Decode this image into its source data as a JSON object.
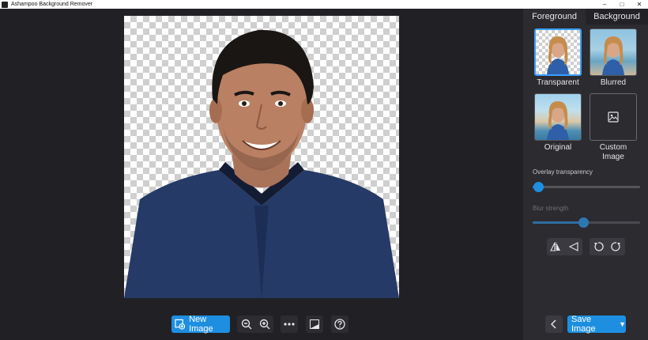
{
  "window": {
    "title": "Ashampoo Background Remover"
  },
  "toolbar": {
    "new_image_label": "New Image",
    "zoom_out_icon": "zoom-out-icon",
    "zoom_in_icon": "zoom-in-icon",
    "more_icon": "more-icon",
    "compare_icon": "compare-icon",
    "help_icon": "help-icon"
  },
  "panel": {
    "tabs": [
      {
        "label": "Foreground"
      },
      {
        "label": "Background"
      }
    ],
    "options": [
      {
        "label": "Transparent",
        "selected": true
      },
      {
        "label": "Blurred",
        "selected": false
      },
      {
        "label": "Original",
        "selected": false
      },
      {
        "label": "Custom Image",
        "selected": false
      }
    ],
    "overlay_transparency": {
      "label": "Overlay transparency",
      "value": 0.05
    },
    "blur_strength": {
      "label": "Blur strength",
      "value": 0.47,
      "enabled": false
    },
    "save_label": "Save Image"
  },
  "colors": {
    "accent": "#1e8fe0",
    "panel": "#2b2b30",
    "canvas": "#212125"
  }
}
